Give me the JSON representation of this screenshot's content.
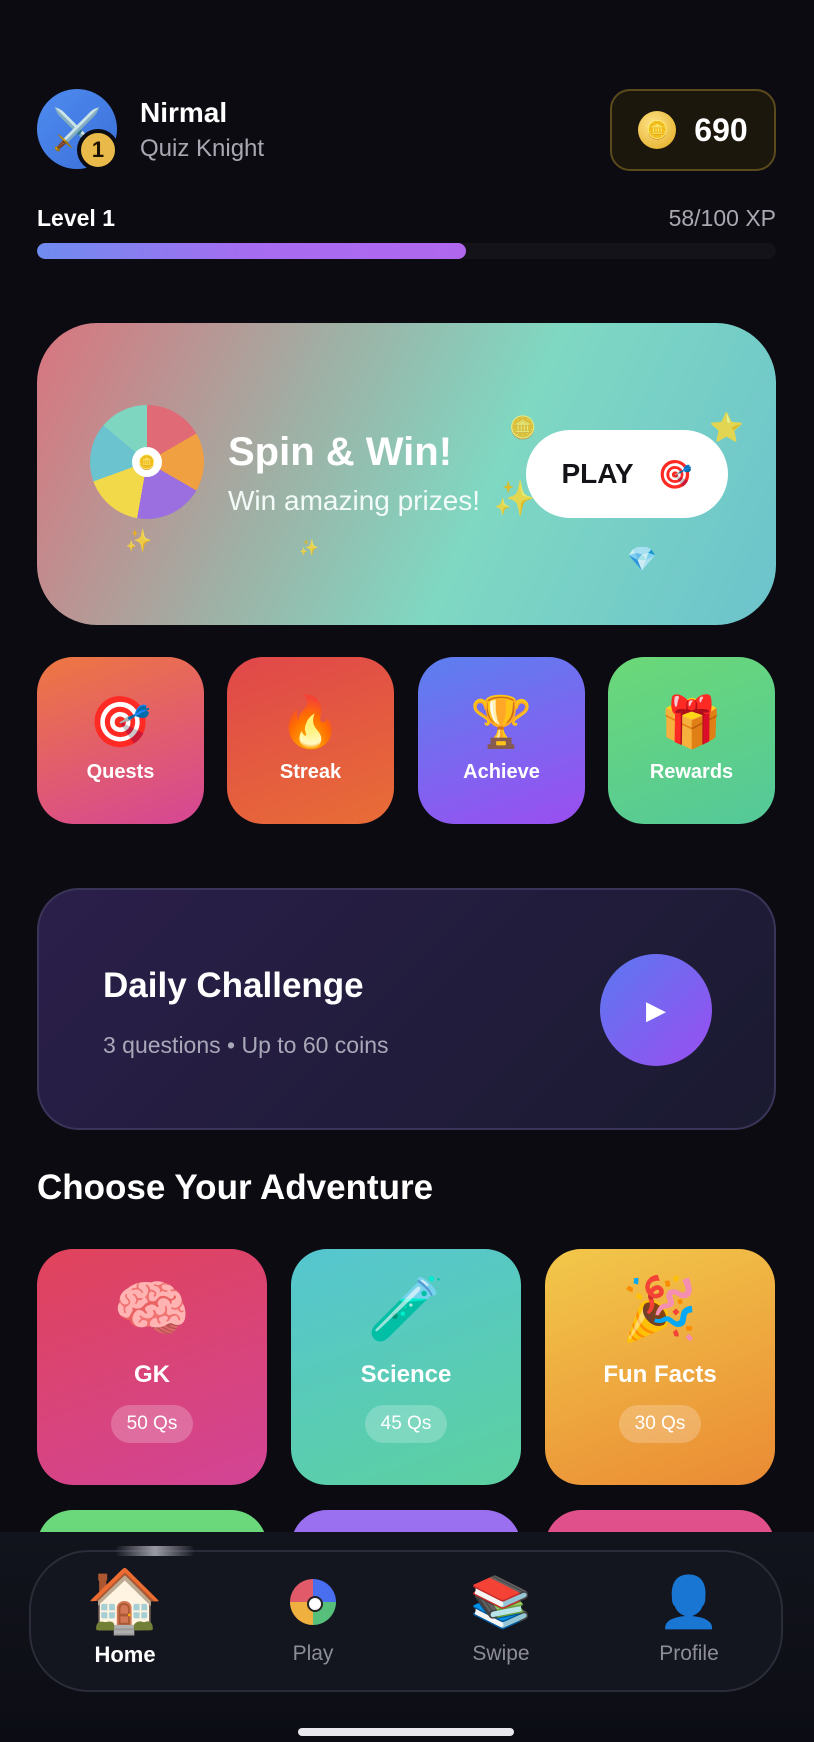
{
  "header": {
    "user_name": "Nirmal",
    "user_title": "Quiz Knight",
    "avatar_emoji": "⚔️",
    "level_badge": "1",
    "coin_icon": "🪙",
    "coins": "690"
  },
  "level": {
    "label": "Level 1",
    "xp_text": "58/100 XP",
    "progress_fraction": 0.58
  },
  "spin_card": {
    "title": "Spin & Win!",
    "subtitle": "Win amazing prizes!",
    "hub_icon": "🪙",
    "play_label": "PLAY",
    "play_icon": "🎯"
  },
  "quick_actions": [
    {
      "icon": "🎯",
      "label": "Quests"
    },
    {
      "icon": "🔥",
      "label": "Streak"
    },
    {
      "icon": "🏆",
      "label": "Achieve"
    },
    {
      "icon": "🎁",
      "label": "Rewards"
    }
  ],
  "daily_challenge": {
    "title": "Daily Challenge",
    "subtitle": "3 questions • Up to 60 coins",
    "play_icon": "▶"
  },
  "adventure": {
    "title": "Choose Your Adventure",
    "categories": [
      {
        "icon": "🧠",
        "name": "GK",
        "count": "50 Qs"
      },
      {
        "icon": "🧪",
        "name": "Science",
        "count": "45 Qs"
      },
      {
        "icon": "🎉",
        "name": "Fun Facts",
        "count": "30 Qs"
      }
    ]
  },
  "bottom_nav": {
    "items": [
      {
        "icon": "🏠",
        "label": "Home",
        "active": true
      },
      {
        "icon": "play-wheel",
        "label": "Play",
        "active": false
      },
      {
        "icon": "📚",
        "label": "Swipe",
        "active": false
      },
      {
        "icon": "👤",
        "label": "Profile",
        "active": false
      }
    ]
  }
}
